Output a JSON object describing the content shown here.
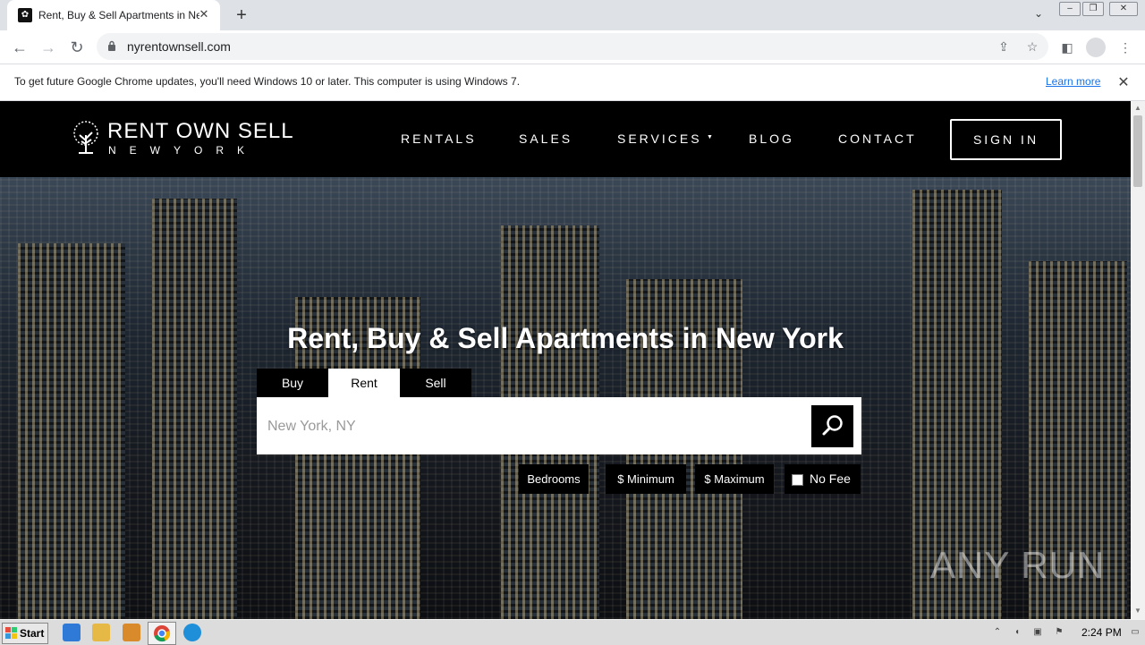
{
  "browser": {
    "tab_title": "Rent, Buy & Sell Apartments in New",
    "tab_close": "✕",
    "new_tab": "+",
    "url": "nyrentownsell.com",
    "infobar_text": "To get future Google Chrome updates, you'll need Windows 10 or later. This computer is using Windows 7.",
    "infobar_link": "Learn more",
    "infobar_close": "✕"
  },
  "site": {
    "logo_name": "RENT OWN SELL",
    "logo_sub": "NEWYORK",
    "nav": [
      "RENTALS",
      "SALES",
      "SERVICES",
      "BLOG",
      "CONTACT"
    ],
    "nav_caret": "▼",
    "signin": "SIGN IN"
  },
  "hero": {
    "title": "Rent, Buy & Sell Apartments in New York",
    "tabs": [
      "Buy",
      "Rent",
      "Sell"
    ],
    "active_tab": "Rent",
    "search_placeholder": "New York, NY",
    "filters": [
      "Bedrooms",
      "$ Minimum",
      "$ Maximum"
    ],
    "no_fee": "No Fee",
    "watermark": "ANY RUN"
  },
  "taskbar": {
    "start": "Start",
    "clock": "2:24 PM"
  },
  "colors": {
    "header_bg": "#000000",
    "link_blue": "#1a73e8",
    "tab_strip": "#dee1e6"
  }
}
